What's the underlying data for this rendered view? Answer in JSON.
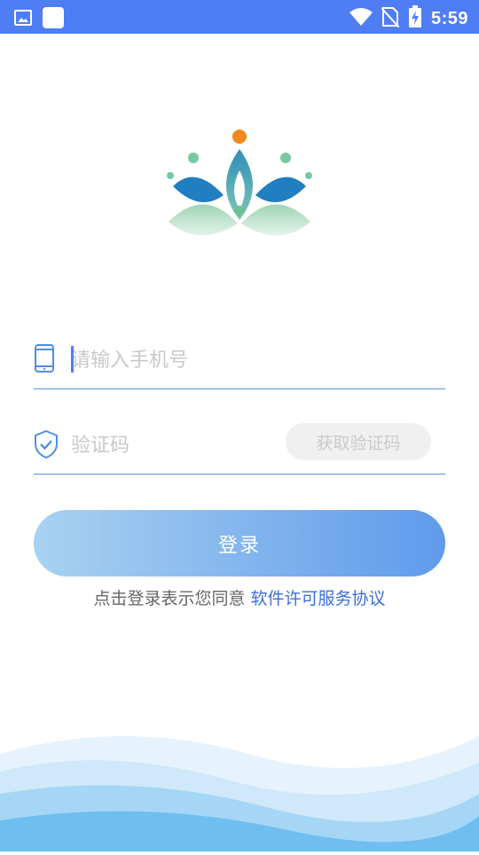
{
  "status_bar": {
    "time": "5:59",
    "icons": [
      "image-icon",
      "square-icon",
      "wifi-icon",
      "no-sim-icon",
      "battery-charging-icon"
    ],
    "background": "#4f7df3"
  },
  "logo": {
    "name": "lotus-logo"
  },
  "phone_field": {
    "placeholder": "请输入手机号",
    "icon": "phone-icon"
  },
  "code_field": {
    "placeholder": "验证码",
    "icon": "shield-check-icon",
    "get_code_label": "获取验证码"
  },
  "login_button": {
    "label": "登录"
  },
  "agreement": {
    "prefix": "点击登录表示您同意 ",
    "link": "软件许可服务协议"
  },
  "colors": {
    "primary": "#4f7df3",
    "link": "#3b6fd9",
    "button_start": "#a9d2f1",
    "button_end": "#5f9aeb"
  }
}
